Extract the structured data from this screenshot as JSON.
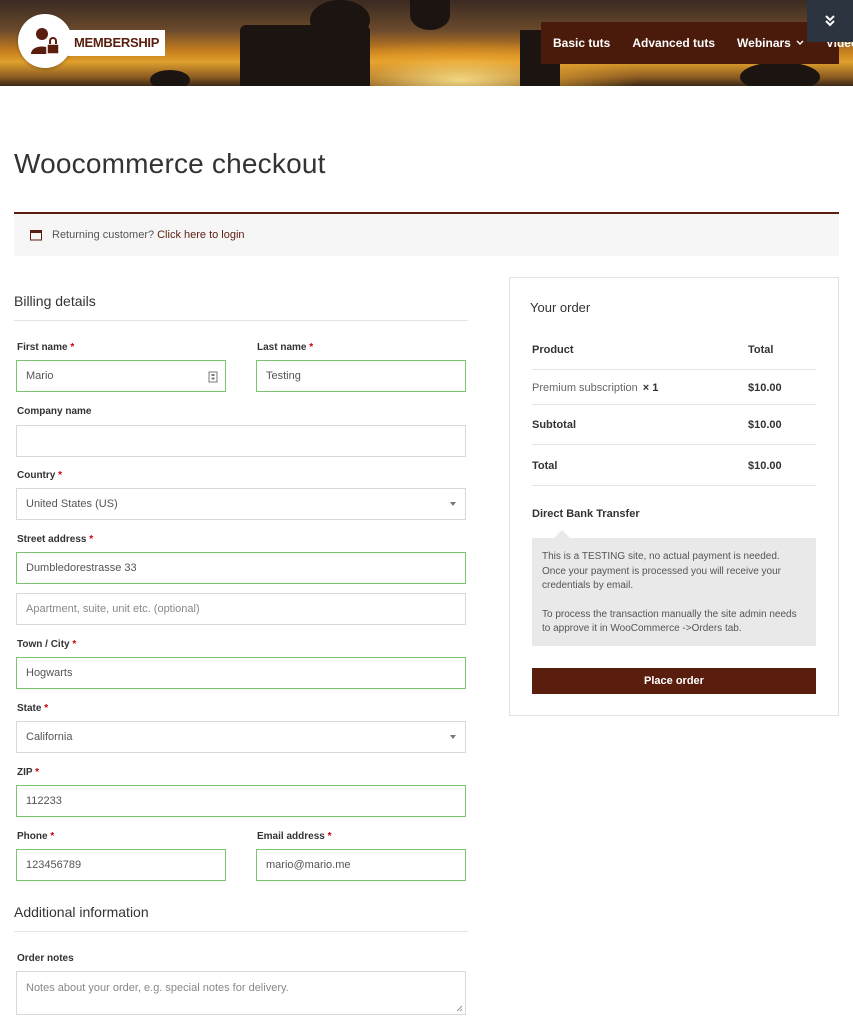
{
  "header": {
    "logo_text": "MEMBERSHIP",
    "nav": [
      {
        "label": "Basic tuts"
      },
      {
        "label": "Advanced tuts"
      },
      {
        "label": "Webinars",
        "has_dropdown": true
      },
      {
        "label": "Videos"
      }
    ],
    "accent_color": "#5a1e0e"
  },
  "page": {
    "title": "Woocommerce checkout"
  },
  "notice": {
    "text": "Returning customer?",
    "link": "Click here to login"
  },
  "billing": {
    "title": "Billing details",
    "first_name": {
      "label": "First name",
      "value": "Mario"
    },
    "last_name": {
      "label": "Last name",
      "value": "Testing"
    },
    "company": {
      "label": "Company name",
      "value": ""
    },
    "country": {
      "label": "Country",
      "value": "United States (US)"
    },
    "street": {
      "label": "Street address",
      "value": "Dumbledorestrasse 33",
      "placeholder2": "Apartment, suite, unit etc. (optional)"
    },
    "city": {
      "label": "Town / City",
      "value": "Hogwarts"
    },
    "state": {
      "label": "State",
      "value": "California"
    },
    "zip": {
      "label": "ZIP",
      "value": "112233"
    },
    "phone": {
      "label": "Phone",
      "value": "123456789"
    },
    "email": {
      "label": "Email address",
      "value": "mario@mario.me"
    },
    "required_mark": "*"
  },
  "additional": {
    "title": "Additional information",
    "notes_label": "Order notes",
    "notes_placeholder": "Notes about your order, e.g. special notes for delivery."
  },
  "order": {
    "title": "Your order",
    "head": {
      "product": "Product",
      "total": "Total"
    },
    "item": {
      "name": "Premium subscription",
      "qty": "× 1",
      "total": "$10.00"
    },
    "subtotal": {
      "label": "Subtotal",
      "value": "$10.00"
    },
    "total": {
      "label": "Total",
      "value": "$10.00"
    },
    "payment_method": "Direct Bank Transfer",
    "payment_desc_1": "This is a TESTING site, no actual payment is needed.",
    "payment_desc_2": "Once your payment is processed you will receive your credentials by email.",
    "payment_desc_3": "To process the transaction manually the site admin needs to approve it in WooCommerce ->Orders tab.",
    "place_order": "Place order"
  }
}
